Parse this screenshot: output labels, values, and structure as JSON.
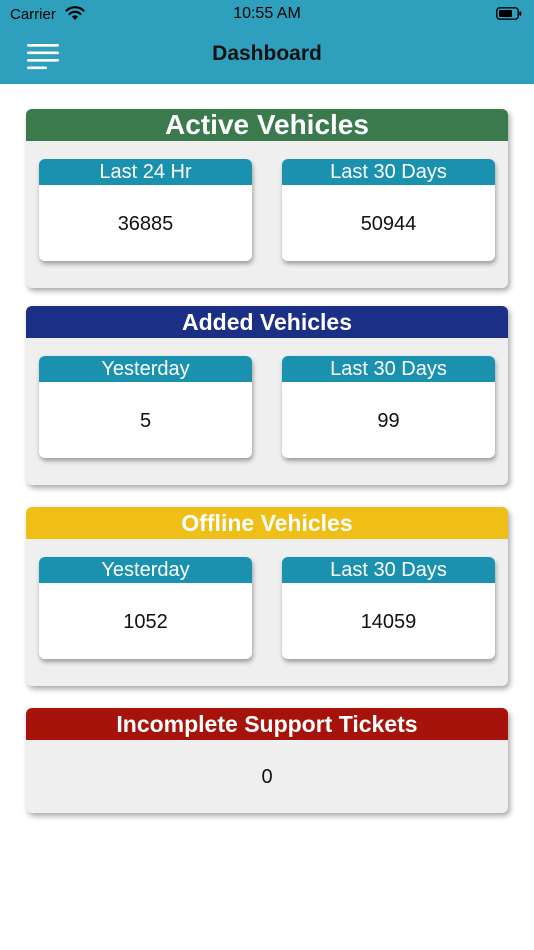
{
  "status_bar": {
    "carrier": "Carrier",
    "time": "10:55 AM"
  },
  "nav": {
    "title": "Dashboard",
    "menu_icon": "hamburger-menu-icon"
  },
  "colors": {
    "nav_bg": "#2ea0be",
    "tile_header": "#1b91b0",
    "active_header": "#3a7a4c",
    "added_header": "#1a2f85",
    "offline_header": "#efbf17",
    "tickets_header": "#a6130a"
  },
  "cards": {
    "active": {
      "title": "Active Vehicles",
      "tiles": [
        {
          "label": "Last 24 Hr",
          "value": "36885"
        },
        {
          "label": "Last 30 Days",
          "value": "50944"
        }
      ]
    },
    "added": {
      "title": "Added Vehicles",
      "tiles": [
        {
          "label": "Yesterday",
          "value": "5"
        },
        {
          "label": "Last 30 Days",
          "value": "99"
        }
      ]
    },
    "offline": {
      "title": "Offline Vehicles",
      "tiles": [
        {
          "label": "Yesterday",
          "value": "1052"
        },
        {
          "label": "Last 30 Days",
          "value": "14059"
        }
      ]
    },
    "tickets": {
      "title": "Incomplete Support Tickets",
      "value": "0"
    }
  }
}
